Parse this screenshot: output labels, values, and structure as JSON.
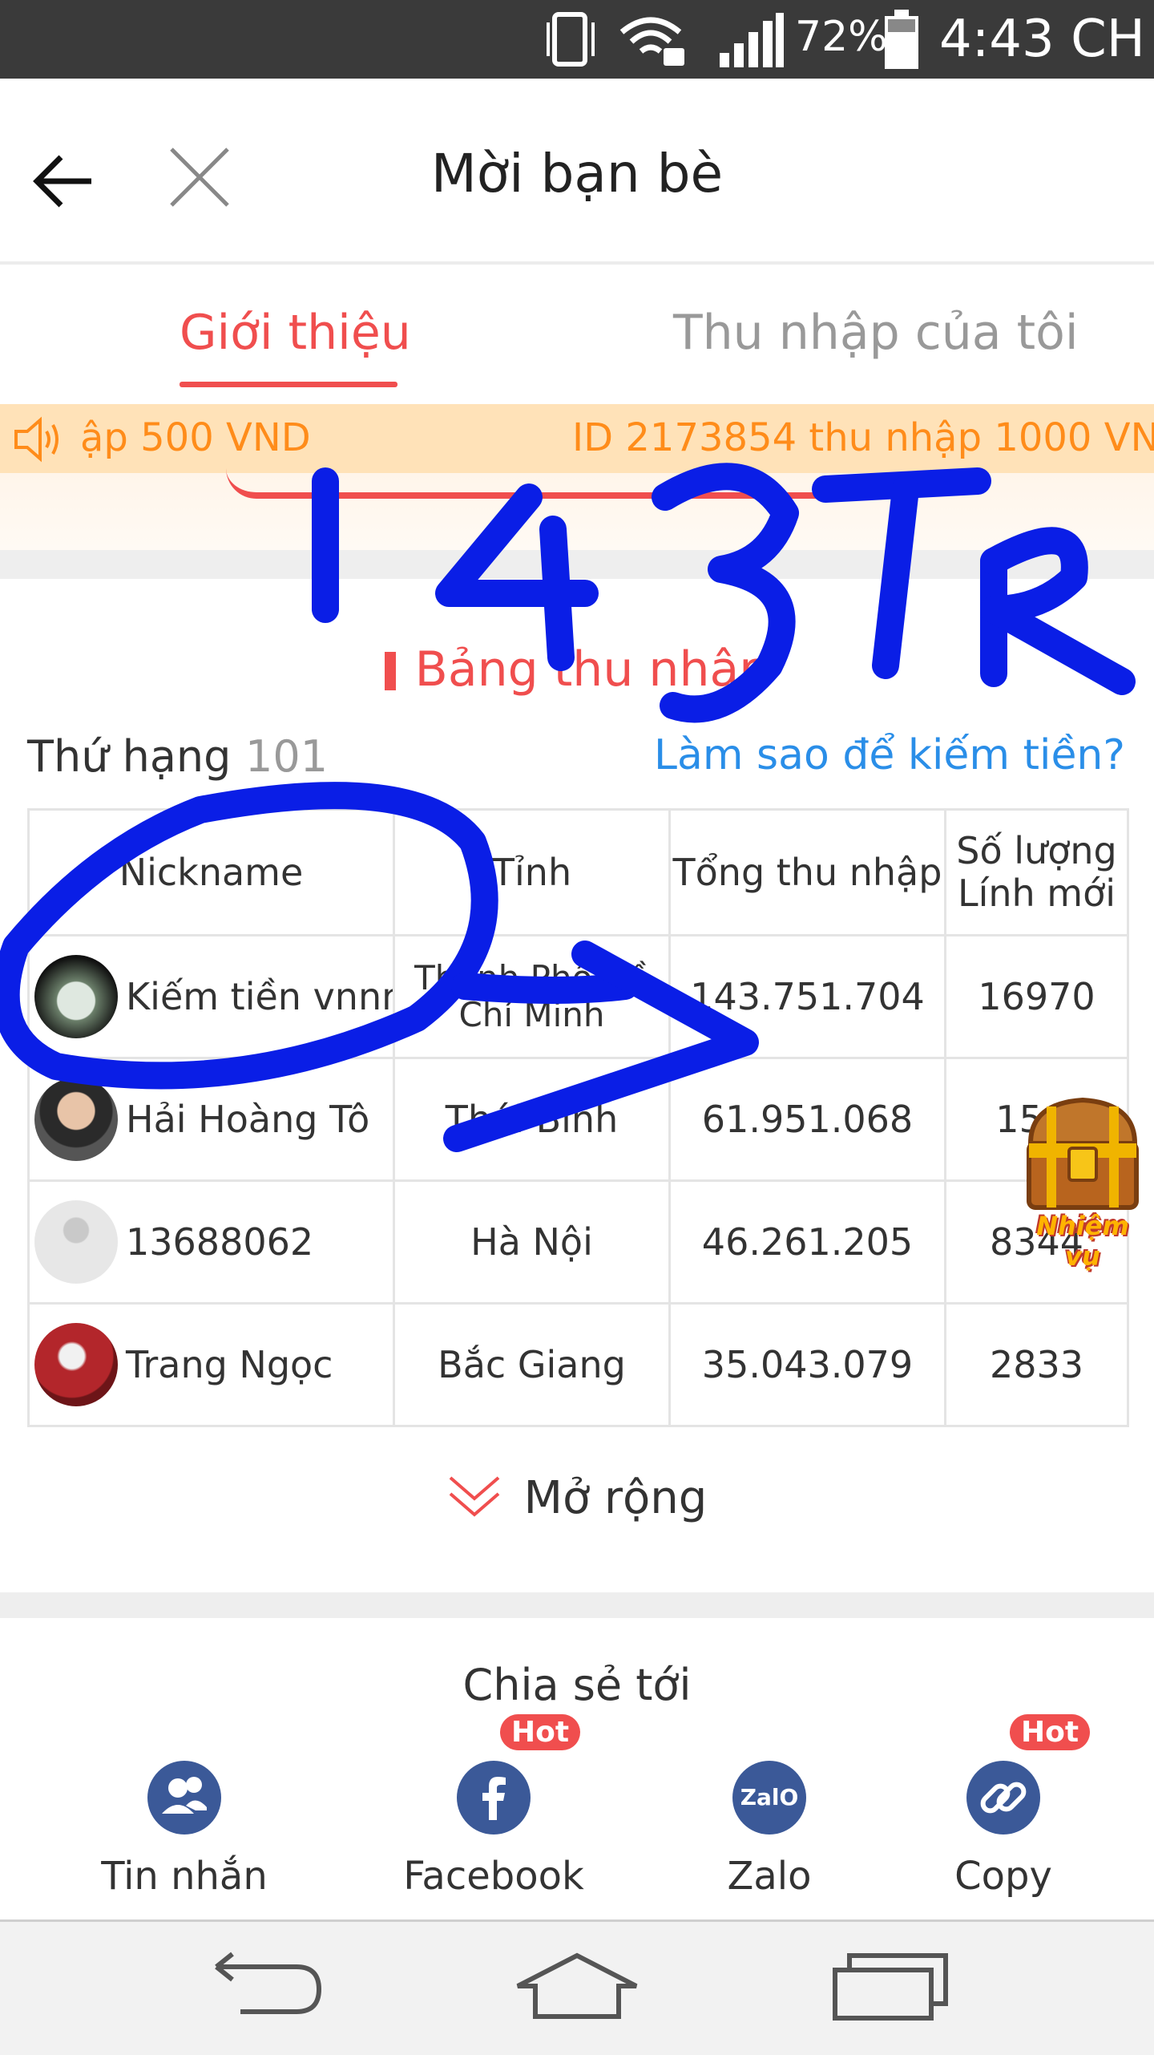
{
  "status_bar": {
    "battery_percent": "72%",
    "time": "4:43 CH",
    "icons": [
      "vibrate-icon",
      "wifi-locked-icon",
      "signal-icon",
      "battery-icon"
    ]
  },
  "header": {
    "title": "Mời bạn bè",
    "back_icon": "back-arrow-icon",
    "close_icon": "close-icon"
  },
  "tabs": [
    {
      "label": "Giới thiệu",
      "active": true
    },
    {
      "label": "Thu nhập của tôi",
      "active": false
    }
  ],
  "marquee": {
    "left_text": "ập 500 VND",
    "right_text": "ID 2173854 thu nhập 1000 VND"
  },
  "income_board": {
    "title": "Bảng thu nhập",
    "rank_label": "Thứ hạng",
    "rank_value": "101",
    "how_to_earn_link": "Làm sao để kiếm tiền?",
    "columns": [
      "Nickname",
      "Tỉnh",
      "Tổng thu nhập",
      "Số lượng\nLính mới"
    ],
    "rows": [
      {
        "nickname": "Kiếm tiền vnnn",
        "province": "Thành Phố Hồ Chí Minh",
        "total_income": "143.751.704",
        "new_recruits": "16970"
      },
      {
        "nickname": "Hải Hoàng Tô",
        "province": "Thái Bình",
        "total_income": "61.951.068",
        "new_recruits": "15..."
      },
      {
        "nickname": "13688062",
        "province": "Hà Nội",
        "total_income": "46.261.205",
        "new_recruits": "8344"
      },
      {
        "nickname": "Trang Ngọc",
        "province": "Bắc Giang",
        "total_income": "35.043.079",
        "new_recruits": "2833"
      }
    ],
    "expand_label": "Mở rộng"
  },
  "share": {
    "title": "Chia sẻ tới",
    "items": [
      {
        "label": "Tin nhắn",
        "icon": "contacts-icon",
        "hot": false
      },
      {
        "label": "Facebook",
        "icon": "facebook-icon",
        "hot": true
      },
      {
        "label": "Zalo",
        "icon": "zalo-icon",
        "hot": false,
        "icon_text": "ZalO"
      },
      {
        "label": "Copy",
        "icon": "link-icon",
        "hot": true
      }
    ],
    "hot_badge": "Hot"
  },
  "floating_reward": {
    "label": "Nhiệm vụ",
    "icon": "treasure-chest-icon"
  },
  "annotation": {
    "text": "143TR",
    "color": "#0a1ee6"
  },
  "colors": {
    "accent": "#f04e4e",
    "link": "#2a8ee8",
    "marquee_bg": "#ffe2b8",
    "marquee_text": "#ff8c1a",
    "share_icon": "#3b5998"
  }
}
